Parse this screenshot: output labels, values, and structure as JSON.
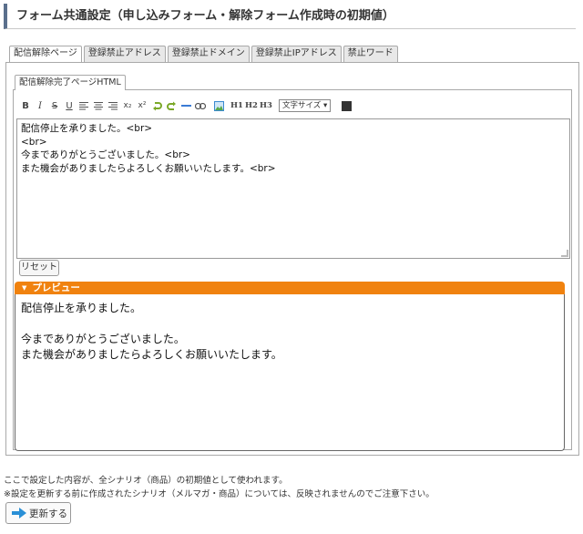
{
  "page": {
    "title": "フォーム共通設定（申し込みフォーム・解除フォーム作成時の初期値）"
  },
  "tabs": [
    {
      "label": "配信解除ページ",
      "active": true
    },
    {
      "label": "登録禁止アドレス",
      "active": false
    },
    {
      "label": "登録禁止ドメイン",
      "active": false
    },
    {
      "label": "登録禁止IPアドレス",
      "active": false
    },
    {
      "label": "禁止ワード",
      "active": false
    }
  ],
  "subtab": {
    "label": "配信解除完了ページHTML"
  },
  "toolbar": {
    "bold": "B",
    "italic": "I",
    "strike": "S",
    "underline": "U",
    "subscript": "x₂",
    "superscript": "x²",
    "h1": "H1",
    "h2": "H2",
    "h3": "H3",
    "fontsize_label": "文字サイズ ▾",
    "text_color": "#333333"
  },
  "editor": {
    "lines": [
      "配信停止を承りました。<br>",
      "<br>",
      "今までありがとうございました。<br>",
      "また機会がありましたらよろしくお願いいたします。<br>"
    ]
  },
  "reset_label": "リセット",
  "preview": {
    "header": "プレビュー",
    "lines": [
      "配信停止を承りました。",
      "",
      "今までありがとうございました。",
      "また機会がありましたらよろしくお願いいたします。"
    ]
  },
  "notes": {
    "line1": "ここで設定した内容が、全シナリオ（商品）の初期値として使われます。",
    "line2": "※設定を更新する前に作成されたシナリオ（メルマガ・商品）については、反映されませんのでご注意下さい。"
  },
  "update_label": "更新する",
  "colors": {
    "accent": "#f0820f",
    "title_bar": "#5a6f8c"
  }
}
